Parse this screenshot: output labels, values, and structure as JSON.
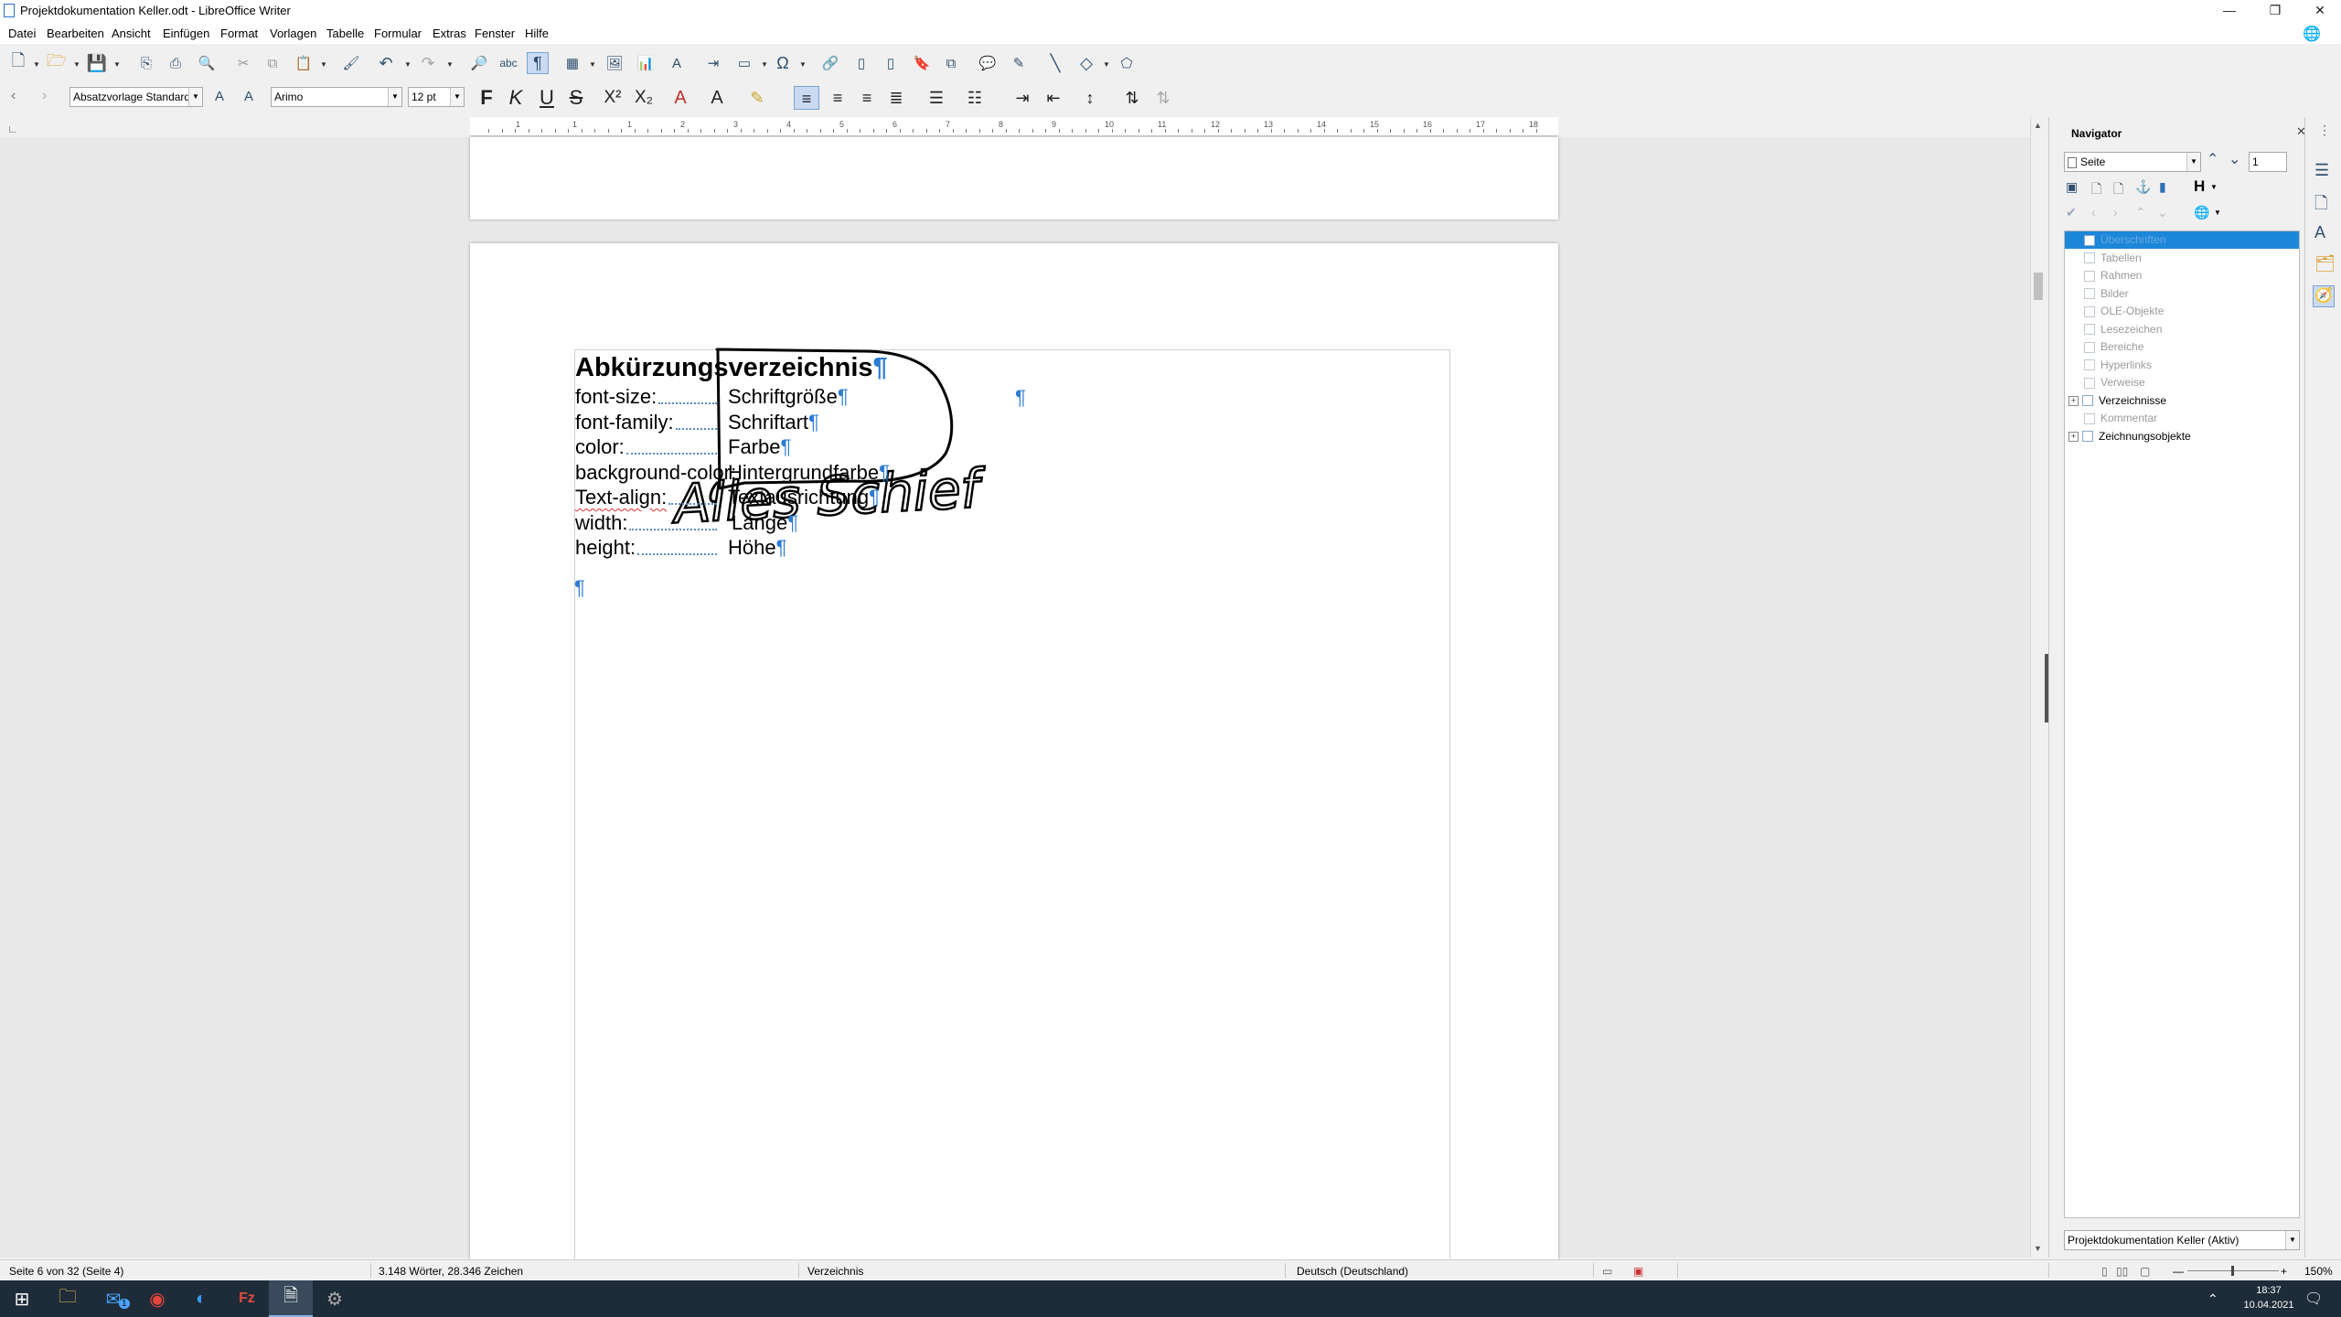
{
  "window": {
    "title": "Projektdokumentation Keller.odt - LibreOffice Writer",
    "min_glyph": "—",
    "max_glyph": "❐",
    "close_glyph": "✕"
  },
  "menu": [
    "Datei",
    "Bearbeiten",
    "Ansicht",
    "Einfügen",
    "Format",
    "Vorlagen",
    "Tabelle",
    "Formular",
    "Extras",
    "Fenster",
    "Hilfe"
  ],
  "formatting": {
    "paragraph_style": "Absatzvorlage Standard",
    "font_name": "Arimo",
    "font_size": "12 pt",
    "bold": "F",
    "italic": "K",
    "underline": "U",
    "strike": "S",
    "superscript": "X²",
    "subscript": "X₂"
  },
  "ruler": {
    "numbers": [
      "1",
      "1",
      "1",
      "2",
      "3",
      "4",
      "5",
      "6",
      "7",
      "8",
      "9",
      "10",
      "11",
      "12",
      "13",
      "14",
      "15",
      "16",
      "17",
      "18"
    ]
  },
  "document": {
    "heading": "Abkürzungsverzeichnis",
    "pilcrow": "¶",
    "entries": [
      {
        "term": "font-size:",
        "meaning": "Schriftgröße"
      },
      {
        "term": "font-family:",
        "meaning": "Schriftart"
      },
      {
        "term": "color:",
        "meaning": "Farbe"
      },
      {
        "term": "background-color:",
        "meaning": "Hintergrundfarbe"
      },
      {
        "term": "Text-align:",
        "meaning": "Textausrichtung"
      },
      {
        "term": "width:",
        "meaning": "Länge"
      },
      {
        "term": "height:",
        "meaning": "Höhe"
      }
    ],
    "handwritten_annotation": "Alles Schief"
  },
  "navigator": {
    "title": "Navigator",
    "close_glyph": "✕",
    "content_type": "Seite",
    "page_number": "1",
    "heading_level_glyph": "H",
    "items": [
      {
        "label": "Überschriften",
        "state": "selected"
      },
      {
        "label": "Tabellen",
        "state": "dim"
      },
      {
        "label": "Rahmen",
        "state": "dim"
      },
      {
        "label": "Bilder",
        "state": "dim"
      },
      {
        "label": "OLE-Objekte",
        "state": "dim"
      },
      {
        "label": "Lesezeichen",
        "state": "dim"
      },
      {
        "label": "Bereiche",
        "state": "dim"
      },
      {
        "label": "Hyperlinks",
        "state": "dim"
      },
      {
        "label": "Verweise",
        "state": "dim"
      },
      {
        "label": "Verzeichnisse",
        "state": "normal"
      },
      {
        "label": "Kommentar",
        "state": "dim"
      },
      {
        "label": "Zeichnungsobjekte",
        "state": "normal"
      }
    ],
    "document_select": "Projektdokumentation Keller (Aktiv)"
  },
  "status": {
    "page": "Seite 6 von 32 (Seite 4)",
    "words": "3.148 Wörter, 28.346 Zeichen",
    "style": "Verzeichnis",
    "language": "Deutsch (Deutschland)",
    "zoom": "150%"
  },
  "taskbar": {
    "time": "18:37",
    "date": "10.04.2021",
    "mail_badge": "1"
  },
  "colors": {
    "accent": "#1c87d9",
    "pilcrow": "#2b7cd3",
    "taskbar": "#1e2b38"
  }
}
